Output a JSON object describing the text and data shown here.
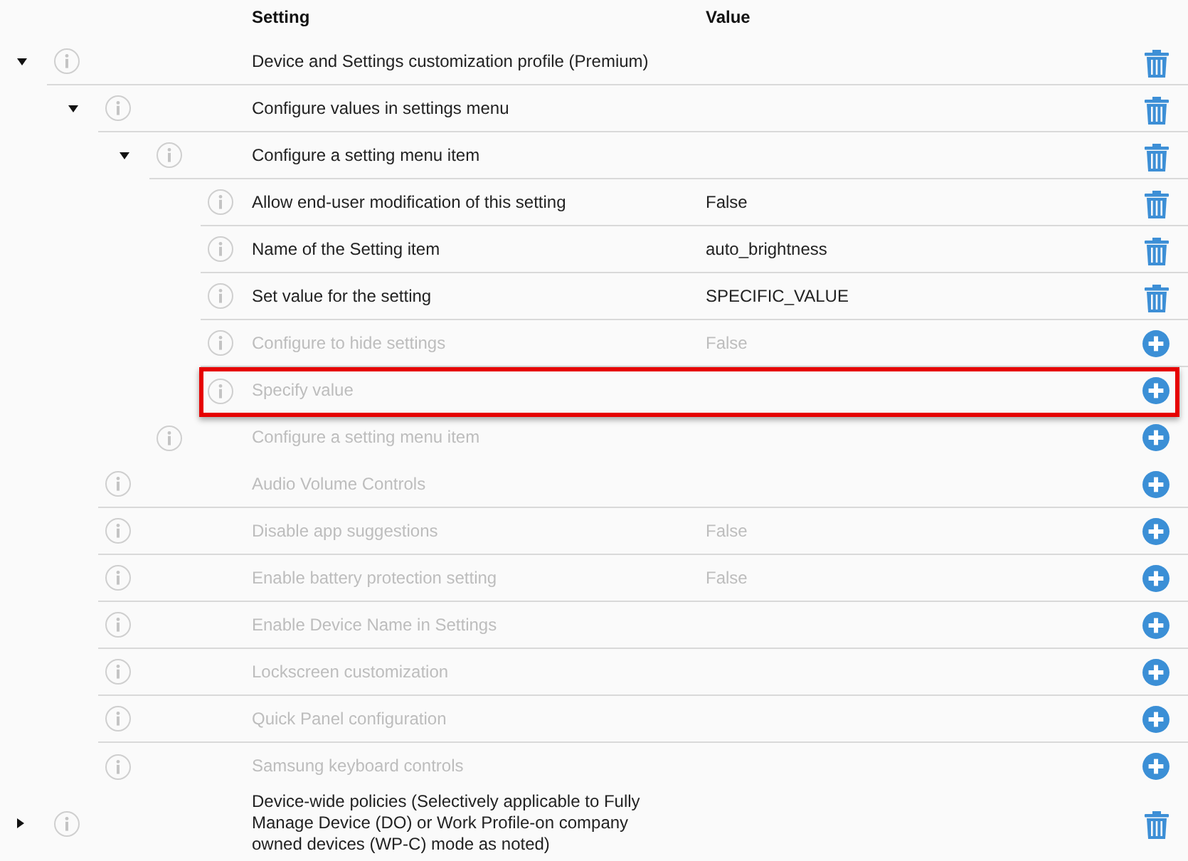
{
  "table": {
    "columns": [
      "Setting",
      "Value"
    ],
    "rows": [
      {
        "label": "Device and Settings customization profile (Premium)",
        "configured": true,
        "expanded": true,
        "children": [
          {
            "label": "Configure values in settings menu",
            "configured": true,
            "expanded": true,
            "children": [
              {
                "label": "Configure a setting menu item",
                "configured": true,
                "expanded": true,
                "children": [
                  {
                    "label": "Allow end-user modification of this setting",
                    "value": "False",
                    "configured": true
                  },
                  {
                    "label": "Name of the Setting item",
                    "value": "auto_brightness",
                    "configured": true
                  },
                  {
                    "label": "Set value for the setting",
                    "value": "SPECIFIC_VALUE",
                    "configured": true
                  },
                  {
                    "label": "Configure to hide settings",
                    "value": "False",
                    "configured": false
                  },
                  {
                    "label": "Specify value",
                    "configured": false,
                    "highlighted": true
                  }
                ]
              },
              {
                "label": "Configure a setting menu item",
                "configured": false
              }
            ]
          },
          {
            "label": "Audio Volume Controls",
            "configured": false
          },
          {
            "label": "Disable app suggestions",
            "value": "False",
            "configured": false
          },
          {
            "label": "Enable battery protection setting",
            "value": "False",
            "configured": false
          },
          {
            "label": "Enable Device Name in Settings",
            "configured": false
          },
          {
            "label": "Lockscreen customization",
            "configured": false
          },
          {
            "label": "Quick Panel configuration",
            "configured": false
          },
          {
            "label": "Samsung keyboard controls",
            "configured": false
          }
        ]
      },
      {
        "label": "Device-wide policies (Selectively applicable to Fully Manage Device (DO) or Work Profile-on company owned devices (WP-C) mode as noted)",
        "configured": true,
        "expanded": false
      }
    ]
  }
}
